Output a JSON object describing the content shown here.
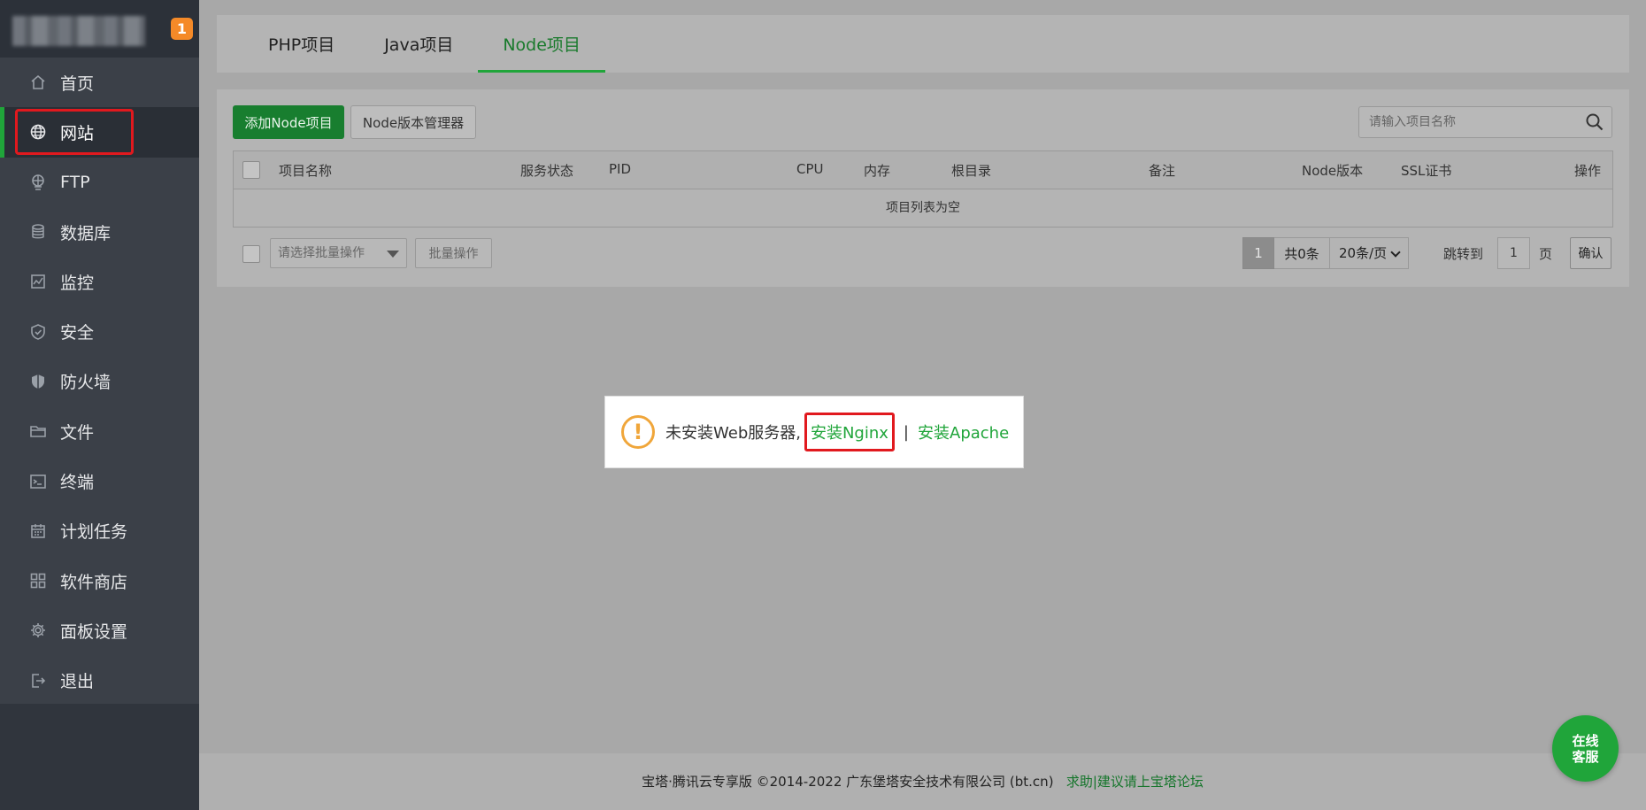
{
  "sidebar": {
    "badge": "1",
    "items": [
      {
        "label": "首页",
        "icon": "home-icon"
      },
      {
        "label": "网站",
        "icon": "globe-icon",
        "active": true
      },
      {
        "label": "FTP",
        "icon": "ftp-icon"
      },
      {
        "label": "数据库",
        "icon": "database-icon"
      },
      {
        "label": "监控",
        "icon": "monitor-icon"
      },
      {
        "label": "安全",
        "icon": "shield-icon"
      },
      {
        "label": "防火墙",
        "icon": "firewall-icon"
      },
      {
        "label": "文件",
        "icon": "folder-icon"
      },
      {
        "label": "终端",
        "icon": "terminal-icon"
      },
      {
        "label": "计划任务",
        "icon": "calendar-icon"
      },
      {
        "label": "软件商店",
        "icon": "apps-icon"
      },
      {
        "label": "面板设置",
        "icon": "gear-icon"
      },
      {
        "label": "退出",
        "icon": "logout-icon"
      }
    ]
  },
  "tabs": [
    {
      "label": "PHP项目"
    },
    {
      "label": "Java项目"
    },
    {
      "label": "Node项目",
      "active": true
    }
  ],
  "toolbar": {
    "add_label": "添加Node项目",
    "version_mgr_label": "Node版本管理器",
    "search_placeholder": "请输入项目名称"
  },
  "table": {
    "columns": [
      "项目名称",
      "服务状态",
      "PID",
      "CPU",
      "内存",
      "根目录",
      "备注",
      "Node版本",
      "SSL证书",
      "操作"
    ],
    "empty_text": "项目列表为空"
  },
  "batch": {
    "select_placeholder": "请选择批量操作",
    "button_label": "批量操作"
  },
  "pagination": {
    "current_page": "1",
    "total": "共0条",
    "page_size": "20条/页",
    "jump_label": "跳转到",
    "jump_value": "1",
    "page_unit": "页",
    "confirm_label": "确认"
  },
  "dialog": {
    "message": "未安装Web服务器,",
    "nginx_link": "安装Nginx",
    "separator": "|",
    "apache_link": "安装Apache"
  },
  "footer": {
    "copyright": "宝塔·腾讯云专享版 ©2014-2022 广东堡塔安全技术有限公司 (bt.cn)",
    "forum_link": "求助|建议请上宝塔论坛"
  },
  "chat": {
    "line1": "在线",
    "line2": "客服"
  },
  "colors": {
    "accent": "#20a53a",
    "sidebar_bg": "#3b4048",
    "highlight": "#e1191e",
    "warning": "#f0a63a"
  }
}
